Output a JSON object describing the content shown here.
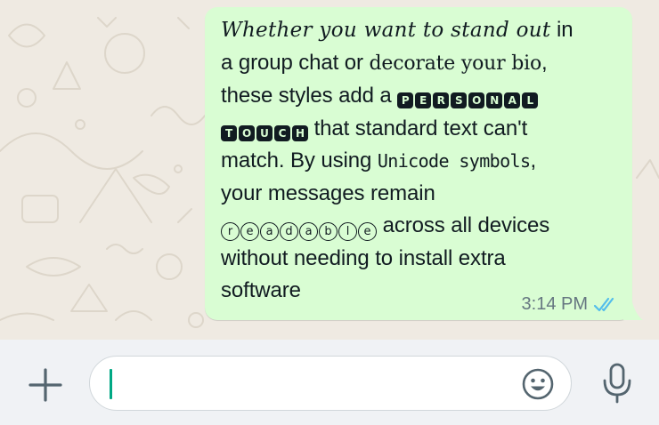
{
  "message": {
    "line1_script": "Whether you want to stand out",
    "line1_rest": " in",
    "line2_start": "a group chat or ",
    "line2_blackletter": "decorate your bio",
    "line2_end": ",",
    "line3_start": "these styles add a ",
    "personal_letters": [
      "P",
      "E",
      "R",
      "S",
      "O",
      "N",
      "A",
      "L"
    ],
    "touch_letters": [
      "T",
      "O",
      "U",
      "C",
      "H"
    ],
    "line4_end": " that standard text can't",
    "line5_start": "match. By using ",
    "line5_styled": "Unicode symbols",
    "line5_end": ",",
    "line6": "your messages remain",
    "readable_letters": [
      "r",
      "e",
      "a",
      "d",
      "a",
      "b",
      "l",
      "e"
    ],
    "line7_end": " across all devices",
    "line8": "without needing to install extra",
    "line9": "software",
    "time": "3:14 PM",
    "status_icon": "double-check-read-icon",
    "status_color": "#53bdeb"
  },
  "composer": {
    "input_value": "",
    "attach_icon": "plus-icon",
    "emoji_icon": "emoji-icon",
    "mic_icon": "microphone-icon",
    "accent_color": "#00a884"
  },
  "theme": {
    "bubble_color": "#d9fdd3",
    "wallpaper_color": "#efeae2",
    "composer_color": "#f0f2f5"
  }
}
